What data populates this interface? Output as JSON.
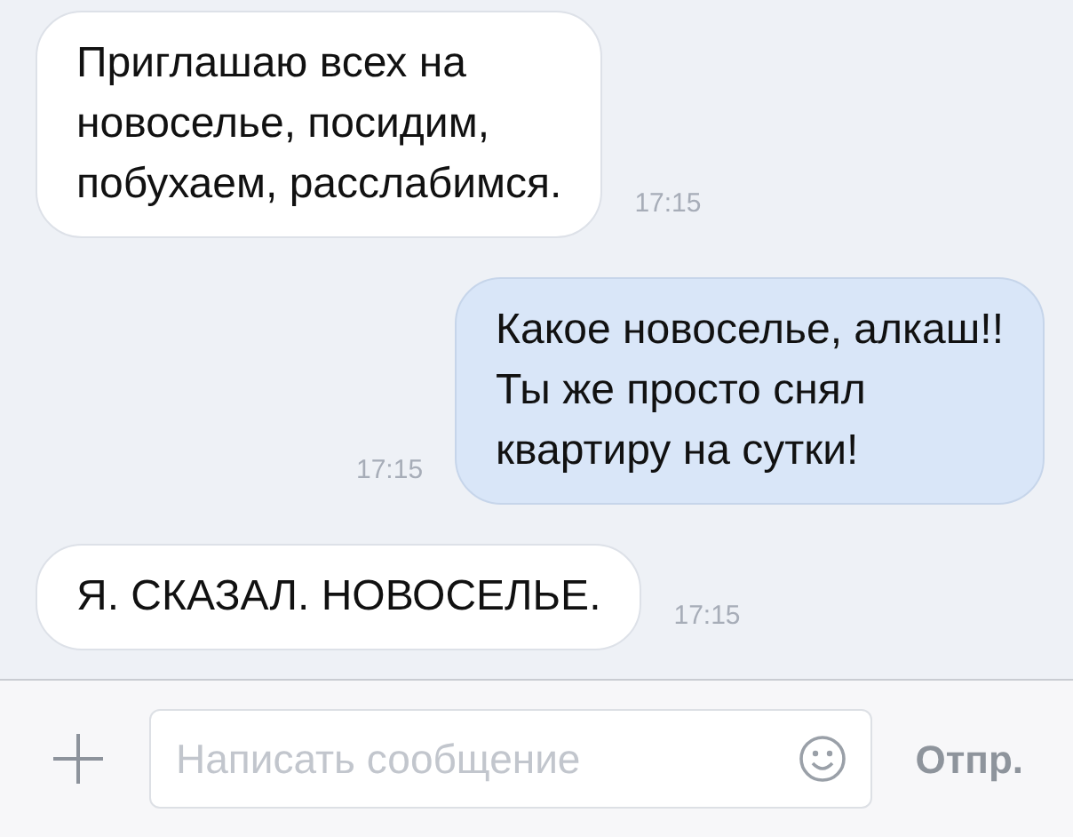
{
  "messages": [
    {
      "kind": "incoming",
      "lines": [
        "Приглашаю всех на",
        "новоселье, посидим,",
        "побухаем, расслабимся."
      ],
      "time": "17:15"
    },
    {
      "kind": "outgoing",
      "lines": [
        "Какое новоселье, алкаш!!",
        "Ты же просто снял",
        "квартиру на сутки!"
      ],
      "time": "17:15"
    },
    {
      "kind": "incoming",
      "lines": [
        "Я. СКАЗАЛ. НОВОСЕЛЬЕ."
      ],
      "time": "17:15"
    }
  ],
  "composer": {
    "placeholder": "Написать сообщение",
    "send": "Отпр."
  }
}
